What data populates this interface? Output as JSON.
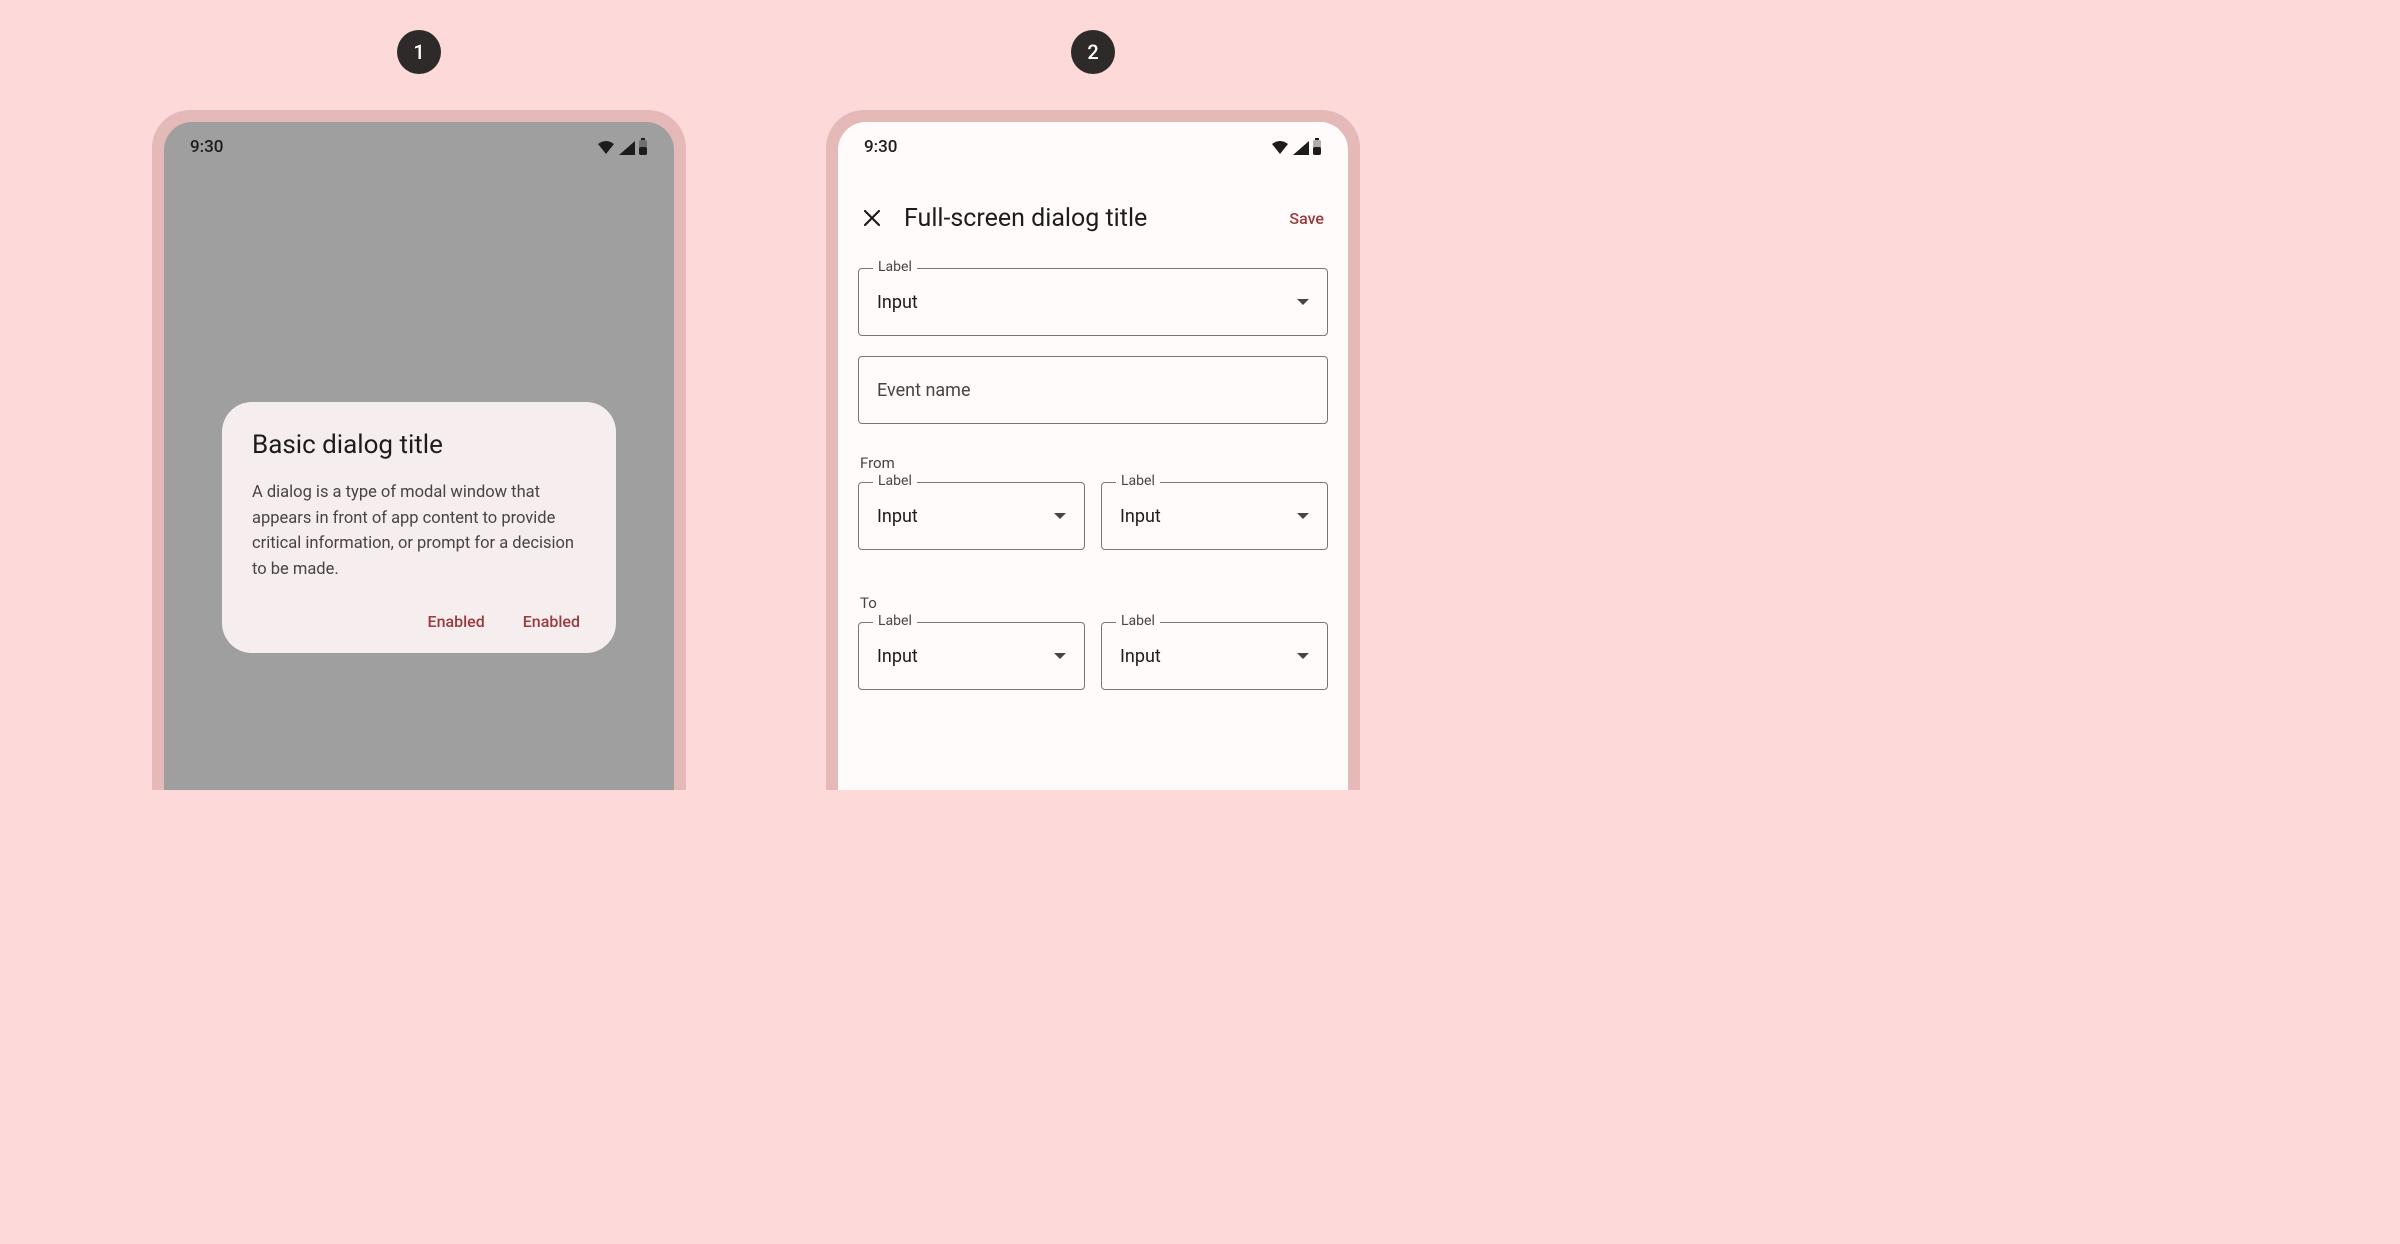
{
  "badges": {
    "one": "1",
    "two": "2"
  },
  "status": {
    "time": "9:30"
  },
  "basic": {
    "title": "Basic dialog title",
    "body": "A dialog is a type of modal window that appears in front of app content to provide critical information, or prompt for a decision to be made.",
    "action1": "Enabled",
    "action2": "Enabled"
  },
  "full": {
    "title": "Full-screen dialog title",
    "save": "Save",
    "field1": {
      "label": "Label",
      "value": "Input"
    },
    "field2": {
      "placeholder": "Event name"
    },
    "from": {
      "heading": "From",
      "a": {
        "label": "Label",
        "value": "Input"
      },
      "b": {
        "label": "Label",
        "value": "Input"
      }
    },
    "to": {
      "heading": "To",
      "a": {
        "label": "Label",
        "value": "Input"
      },
      "b": {
        "label": "Label",
        "value": "Input"
      }
    }
  }
}
